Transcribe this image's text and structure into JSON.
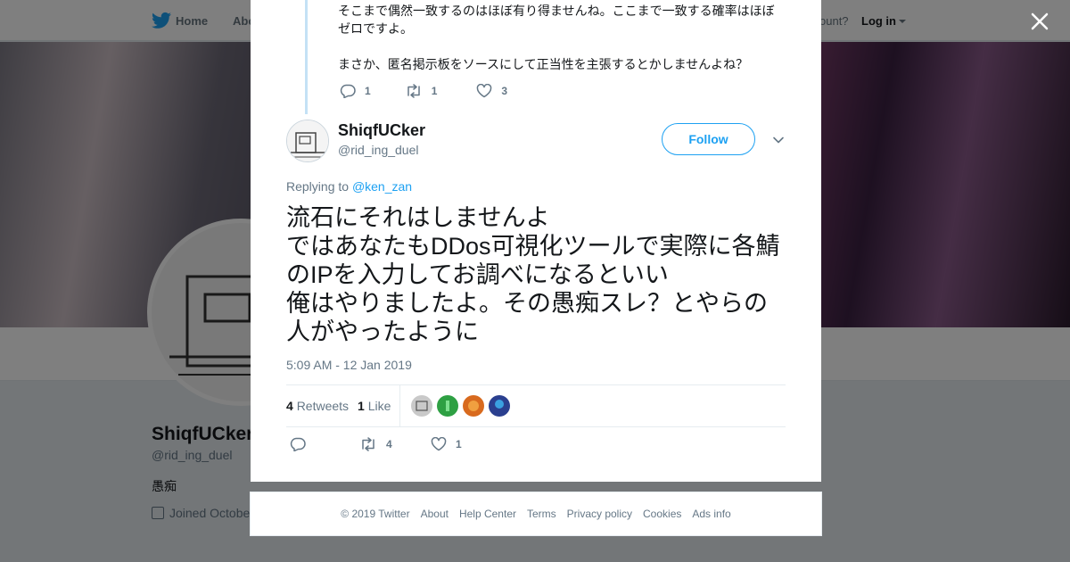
{
  "nav": {
    "home_label": "Home",
    "about_label": "Abo",
    "account_prompt": "ccount?",
    "login_label": "Log in"
  },
  "profile": {
    "name": "ShiqfUCker",
    "handle": "@rid_ing_duel",
    "bio": "愚痴",
    "joined": "Joined Octobe"
  },
  "previous_tweet": {
    "text_line1": "そこまで偶然一致するのはほぼ有り得ませんね。ここまで一致する確率はほぼゼロですよ。",
    "text_line2": "まさか、匿名掲示板をソースにして正当性を主張するとかしませんよね？",
    "reply_count": "1",
    "retweet_count": "1",
    "like_count": "3"
  },
  "tweet": {
    "author_name": "ShiqfUCker",
    "author_handle": "@rid_ing_duel",
    "follow_label": "Follow",
    "replying_prefix": "Replying to",
    "replying_to": "@ken_zan",
    "text": "流石にそれはしませんよ\nではあなたもDDos可視化ツールで実際に各鯖のIPを入力してお調べになるといい\n俺はやりましたよ。その愚痴スレ？とやらの人がやったように",
    "timestamp": "5:09 AM - 12 Jan 2019",
    "retweets_count": "4",
    "retweets_label": "Retweets",
    "likes_count": "1",
    "likes_label": "Like",
    "action_retweet_count": "4",
    "action_like_count": "1",
    "avatar_mini_colors": [
      "#c9c9c9",
      "#2ea043",
      "#d86a1e",
      "#2a3f8f"
    ]
  },
  "footer": {
    "copyright": "© 2019 Twitter",
    "links": [
      "About",
      "Help Center",
      "Terms",
      "Privacy policy",
      "Cookies",
      "Ads info"
    ]
  },
  "colors": {
    "brand": "#1da1f2",
    "muted": "#657786",
    "thread": "#c4e1f5"
  },
  "icons": [
    "twitter-bird-icon",
    "close-icon",
    "reply-icon",
    "retweet-icon",
    "like-icon",
    "chevron-down-icon",
    "calendar-icon"
  ]
}
